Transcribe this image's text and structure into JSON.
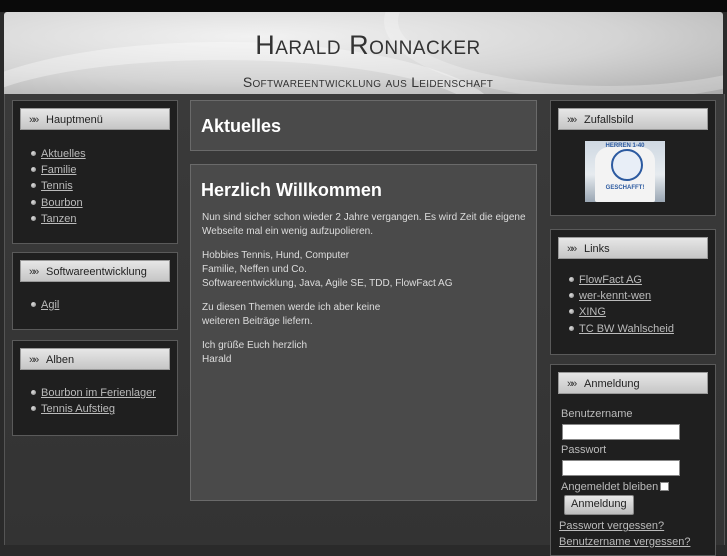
{
  "site": {
    "title": "Harald Ronnacker",
    "slogan": "Softwareentwicklung aus Leidenschaft"
  },
  "modules": {
    "hauptmenu": {
      "title": "Hauptmenü",
      "items": [
        "Aktuelles",
        "Familie",
        "Tennis",
        "Bourbon",
        "Tanzen"
      ]
    },
    "softwareentwicklung": {
      "title": "Softwareentwicklung",
      "items": [
        "Agil"
      ]
    },
    "alben": {
      "title": "Alben",
      "items": [
        "Bourbon im Ferienlager",
        "Tennis Aufstieg"
      ]
    },
    "zufallsbild": {
      "title": "Zufallsbild",
      "photo_text_top": "HERREN 1-40",
      "photo_text_bottom": "GESCHAFFT!"
    },
    "links": {
      "title": "Links",
      "items": [
        "FlowFact AG",
        "wer-kennt-wen",
        "XING",
        "TC BW Wahlscheid"
      ]
    },
    "anmeldung": {
      "title": "Anmeldung",
      "username_label": "Benutzername",
      "username_value": "",
      "password_label": "Passwort",
      "password_value": "",
      "remember_label": "Angemeldet bleiben",
      "login_button": "Anmeldung",
      "forgot_password": "Passwort vergessen?",
      "forgot_username": "Benutzername vergessen?"
    }
  },
  "main": {
    "section_title": "Aktuelles",
    "article_title": "Herzlich Willkommen",
    "paragraphs": [
      "Nun sind sicher schon wieder 2 Jahre vergangen. Es wird Zeit die eigene Webseite mal ein wenig aufzupolieren.",
      "Hobbies Tennis, Hund, Computer\nFamilie, Neffen und Co.\nSoftwareentwicklung, Java, Agile SE, TDD, FlowFact AG",
      "Zu diesen Themen werde ich aber keine\nweiteren Beiträge liefern.",
      "Ich grüße Euch herzlich\nHarald"
    ]
  }
}
